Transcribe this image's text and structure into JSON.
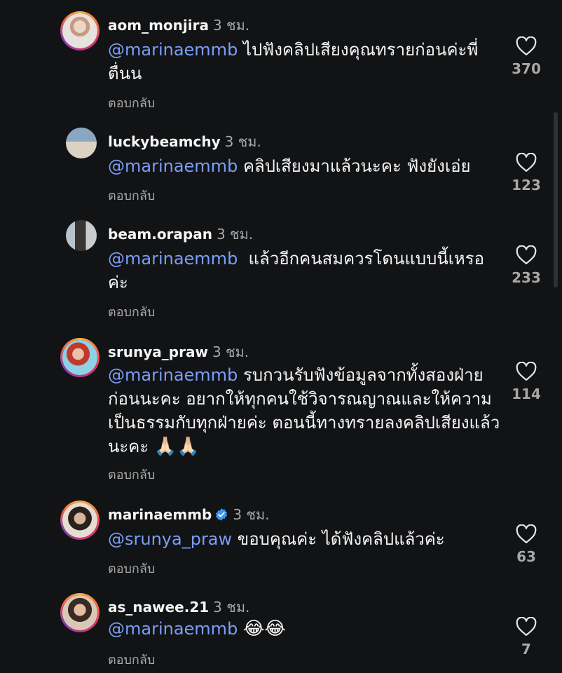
{
  "time_ago": "3 ชม.",
  "reply_label": "ตอบกลับ",
  "comments": [
    {
      "username": "aom_monjira",
      "mention": "@marinaemmb",
      "text": "ไปฟังคลิปเสียงคุณทรายก่อนค่ะพี่ตื่นน",
      "likes": "370"
    },
    {
      "username": "luckybeamchy",
      "mention": "@marinaemmb",
      "text": "คลิปเสียงมาแล้วนะคะ ฟังยังเอ่ย",
      "likes": "123"
    },
    {
      "username": "beam.orapan",
      "mention": "@marinaemmb",
      "text": "  แล้วอีกคนสมควรโดนแบบนี้เหรอค่ะ",
      "likes": "233"
    },
    {
      "username": "srunya_praw",
      "mention": "@marinaemmb",
      "text": "รบกวนรับฟังข้อมูลจากทั้งสองฝ่ายก่อนนะคะ อยากให้ทุกคนใช้วิจารณญาณและให้ความเป็นธรรมกับทุกฝ่ายค่ะ ตอนนี้ทางทรายลงคลิปเสียงแล้วนะคะ",
      "emoji": "🙏🏻🙏🏻",
      "likes": "114"
    },
    {
      "username": "marinaemmb",
      "verified": true,
      "mention": "@srunya_praw",
      "text": "ขอบคุณค่ะ ได้ฟังคลิปแล้วค่ะ",
      "likes": "63"
    },
    {
      "username": "as_nawee.21",
      "mention": "@marinaemmb",
      "text": "",
      "emoji": "😂😂",
      "likes": "7"
    }
  ],
  "colors": {
    "background": "#121315",
    "mention": "#7a9ef7",
    "secondary_text": "#a8a8a8",
    "verified": "#3897f0"
  },
  "icons": {
    "like": "heart-outline-icon",
    "verified": "verified-badge-icon"
  }
}
